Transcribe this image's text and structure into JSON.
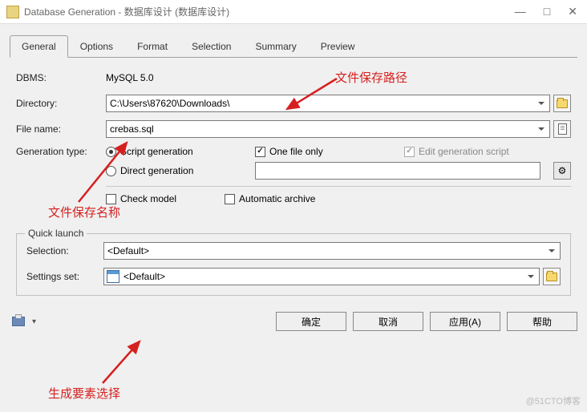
{
  "title": "Database Generation - 数据库设计 (数据库设计)",
  "tabs": [
    "General",
    "Options",
    "Format",
    "Selection",
    "Summary",
    "Preview"
  ],
  "form": {
    "dbms_label": "DBMS:",
    "dbms_value": "MySQL 5.0",
    "directory_label": "Directory:",
    "directory_value": "C:\\Users\\87620\\Downloads\\",
    "filename_label": "File name:",
    "filename_value": "crebas.sql",
    "gentype_label": "Generation type:",
    "script_generation": "Script generation",
    "direct_generation": "Direct generation",
    "one_file_only": "One file only",
    "edit_generation_script": "Edit generation script",
    "check_model": "Check model",
    "automatic_archive": "Automatic archive"
  },
  "quicklaunch": {
    "legend": "Quick launch",
    "selection_label": "Selection:",
    "selection_value": "<Default>",
    "settings_label": "Settings set:",
    "settings_value": "<Default>"
  },
  "buttons": {
    "ok": "确定",
    "cancel": "取消",
    "apply": "应用(A)",
    "help": "帮助"
  },
  "annotations": {
    "path": "文件保存路径",
    "name": "文件保存名称",
    "select": "生成要素选择"
  },
  "watermark": "@51CTO博客"
}
